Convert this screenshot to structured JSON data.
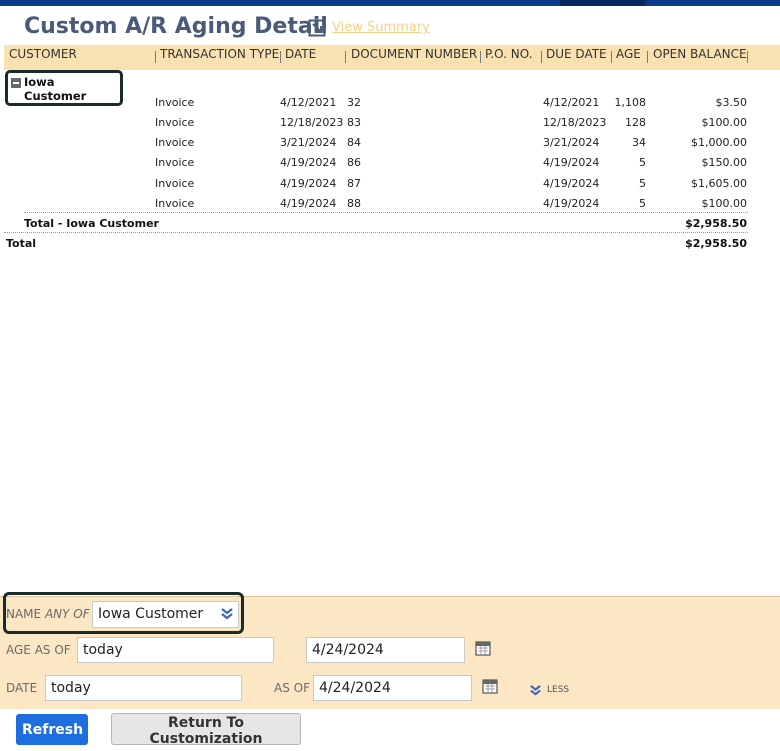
{
  "page": {
    "title": "Custom A/R Aging Detail",
    "view_summary_link": "View Summary"
  },
  "columns": [
    "CUSTOMER",
    "TRANSACTION TYPE",
    "DATE",
    "DOCUMENT NUMBER",
    "P.O. NO.",
    "DUE DATE",
    "AGE",
    "OPEN BALANCE"
  ],
  "customer_group": {
    "name": "Iowa Customer",
    "rows": [
      {
        "type": "Invoice",
        "date": "4/12/2021",
        "doc": "32",
        "po": "",
        "due": "4/12/2021",
        "age": "1,108",
        "balance": "$3.50"
      },
      {
        "type": "Invoice",
        "date": "12/18/2023",
        "doc": "83",
        "po": "",
        "due": "12/18/2023",
        "age": "128",
        "balance": "$100.00"
      },
      {
        "type": "Invoice",
        "date": "3/21/2024",
        "doc": "84",
        "po": "",
        "due": "3/21/2024",
        "age": "34",
        "balance": "$1,000.00"
      },
      {
        "type": "Invoice",
        "date": "4/19/2024",
        "doc": "86",
        "po": "",
        "due": "4/19/2024",
        "age": "5",
        "balance": "$150.00"
      },
      {
        "type": "Invoice",
        "date": "4/19/2024",
        "doc": "87",
        "po": "",
        "due": "4/19/2024",
        "age": "5",
        "balance": "$1,605.00"
      },
      {
        "type": "Invoice",
        "date": "4/19/2024",
        "doc": "88",
        "po": "",
        "due": "4/19/2024",
        "age": "5",
        "balance": "$100.00"
      }
    ],
    "subtotal_label": "Total - Iowa Customer",
    "subtotal_value": "$2,958.50"
  },
  "grand_total": {
    "label": "Total",
    "value": "$2,958.50"
  },
  "filters": {
    "name_label": "NAME",
    "name_qualifier": "ANY OF",
    "name_value": "Iowa Customer",
    "age_as_of_label": "AGE AS OF",
    "age_as_of_value": "today",
    "age_as_of_date": "4/24/2024",
    "date_label": "DATE",
    "date_value": "today",
    "as_of_label": "AS OF",
    "as_of_date": "4/24/2024",
    "less_label": "LESS"
  },
  "buttons": {
    "refresh": "Refresh",
    "return": "Return To Customization"
  },
  "colors": {
    "header_bg": "#f9e1b1",
    "filter_bg": "#fbe7c3",
    "title": "#4a5b78",
    "primary_button": "#1e6ee0",
    "top_bar": "#0e3a8a"
  }
}
